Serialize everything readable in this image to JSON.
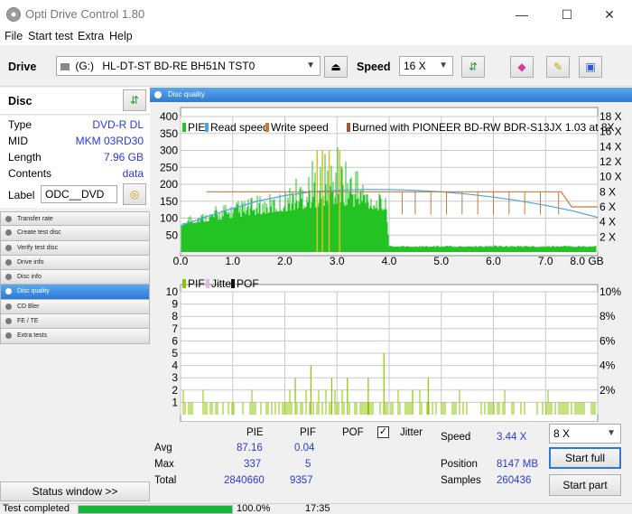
{
  "app": {
    "title": "Opti Drive Control 1.80",
    "menu": [
      "File",
      "Start test",
      "Extra",
      "Help"
    ],
    "win_minimize": "—",
    "win_maximize": "☐",
    "win_close": "✕"
  },
  "toolbar": {
    "drive_label": "Drive",
    "drive_letter": "(G:)",
    "drive_name": "HL-DT-ST BD-RE  BH51N TST0",
    "speed_label": "Speed",
    "speed_value": "16 X"
  },
  "disc": {
    "heading": "Disc",
    "rows": [
      {
        "key": "Type",
        "value": "DVD-R DL"
      },
      {
        "key": "MID",
        "value": "MKM 03RD30"
      },
      {
        "key": "Length",
        "value": "7.96 GB"
      },
      {
        "key": "Contents",
        "value": "data"
      }
    ],
    "label_key": "Label",
    "label_value": "ODC__DVD"
  },
  "nav": [
    {
      "label": "Transfer rate",
      "active": false
    },
    {
      "label": "Create test disc",
      "active": false
    },
    {
      "label": "Verify test disc",
      "active": false
    },
    {
      "label": "Drive info",
      "active": false
    },
    {
      "label": "Disc info",
      "active": false
    },
    {
      "label": "Disc quality",
      "active": true
    },
    {
      "label": "CD Bler",
      "active": false
    },
    {
      "label": "FE / TE",
      "active": false
    },
    {
      "label": "Extra tests",
      "active": false
    }
  ],
  "status_window_button": "Status window >>",
  "panel_title": "Disc quality",
  "chart_data": [
    {
      "type": "area",
      "legend": [
        "PIE",
        "Read speed",
        "Write speed",
        "Burned with PIONEER BD-RW  BDR-S13JX 1.03 at 8X"
      ],
      "x_ticks": [
        "0.0",
        "1.0",
        "2.0",
        "3.0",
        "4.0",
        "5.0",
        "6.0",
        "7.0",
        "8.0 GB"
      ],
      "y_left_ticks": [
        "400",
        "350",
        "300",
        "250",
        "200",
        "150",
        "100",
        "50"
      ],
      "y_right_ticks": [
        "18 X",
        "16 X",
        "14 X",
        "12 X",
        "10 X",
        "8 X",
        "6 X",
        "4 X",
        "2 X"
      ],
      "xlim": [
        0,
        8.0
      ],
      "ylim": [
        0,
        400
      ],
      "y2lim": [
        0,
        18
      ],
      "pie_envelope": {
        "x": [
          0.0,
          0.1,
          0.3,
          0.5,
          0.7,
          0.9,
          1.0,
          1.2,
          1.4,
          1.6,
          1.8,
          2.0,
          2.2,
          2.4,
          2.6,
          2.8,
          3.0,
          3.2,
          3.4,
          3.6,
          3.8,
          3.95,
          4.0,
          4.5,
          5.0,
          6.0,
          7.0,
          7.9
        ],
        "y": [
          60,
          110,
          130,
          120,
          140,
          150,
          150,
          160,
          165,
          170,
          175,
          185,
          230,
          260,
          285,
          300,
          320,
          300,
          280,
          210,
          175,
          160,
          20,
          20,
          20,
          20,
          20,
          20
        ]
      },
      "pie_base": {
        "x": [
          0.0,
          1.0,
          2.0,
          3.0,
          3.95,
          4.0,
          8.0
        ],
        "y": [
          80,
          100,
          120,
          140,
          120,
          15,
          15
        ]
      },
      "read_speed": {
        "x": [
          0.0,
          0.5,
          1.0,
          1.5,
          2.0,
          2.5,
          3.0,
          3.5,
          4.0,
          4.5,
          5.0,
          5.5,
          6.0,
          6.5,
          7.0,
          7.5,
          8.0
        ],
        "y": [
          3.5,
          4.7,
          5.8,
          6.8,
          7.5,
          8.0,
          8.2,
          8.3,
          8.3,
          8.2,
          8.0,
          7.7,
          7.3,
          6.8,
          6.2,
          5.5,
          4.6
        ]
      },
      "write_speed": {
        "x": [
          0.5,
          7.3,
          7.5,
          8.0
        ],
        "y": [
          8,
          8,
          6,
          6
        ]
      },
      "annotations": []
    },
    {
      "type": "bar",
      "legend": [
        "PIF",
        "Jitter",
        "POF"
      ],
      "x_ticks": [
        "0.0",
        "1.0",
        "2.0",
        "3.0",
        "4.0",
        "5.0",
        "6.0",
        "7.0",
        "8.0 GB"
      ],
      "y_left_ticks": [
        "10",
        "9",
        "8",
        "7",
        "6",
        "5",
        "4",
        "3",
        "2",
        "1"
      ],
      "y_right_ticks": [
        "10%",
        "8%",
        "6%",
        "4%",
        "2%"
      ],
      "xlim": [
        0,
        8.0
      ],
      "ylim": [
        0,
        10
      ],
      "y2lim": [
        0,
        10
      ],
      "pif_spikes": {
        "x": [
          2.2,
          2.5,
          2.9,
          3.2,
          3.6,
          3.9,
          4.45,
          4.75
        ],
        "y": [
          3,
          4,
          3,
          3,
          3,
          5,
          2,
          3
        ]
      }
    }
  ],
  "stats": {
    "col_pie": "PIE",
    "col_pif": "PIF",
    "col_pof": "POF",
    "jitter_label": "Jitter",
    "jitter_check": "✓",
    "avg_label": "Avg",
    "avg_pie": "87.16",
    "avg_pif": "0.04",
    "max_label": "Max",
    "max_pie": "337",
    "max_pif": "5",
    "total_label": "Total",
    "total_pie": "2840660",
    "total_pif": "9357",
    "speed_label": "Speed",
    "speed_value": "3.44 X",
    "position_label": "Position",
    "position_value": "8147 MB",
    "samples_label": "Samples",
    "samples_value": "260436",
    "speed_select": "8 X",
    "start_full": "Start full",
    "start_part": "Start part"
  },
  "statusbar": {
    "text": "Test completed",
    "progress": 100,
    "progress_text": "100.0%",
    "time": "17:35"
  },
  "colors": {
    "pie": "#22c322",
    "pif": "#8bc400",
    "read": "#4aa3e8",
    "write": "#c87a3c",
    "accent": "#2a78d8",
    "value_blue": "#2a3ad8"
  }
}
